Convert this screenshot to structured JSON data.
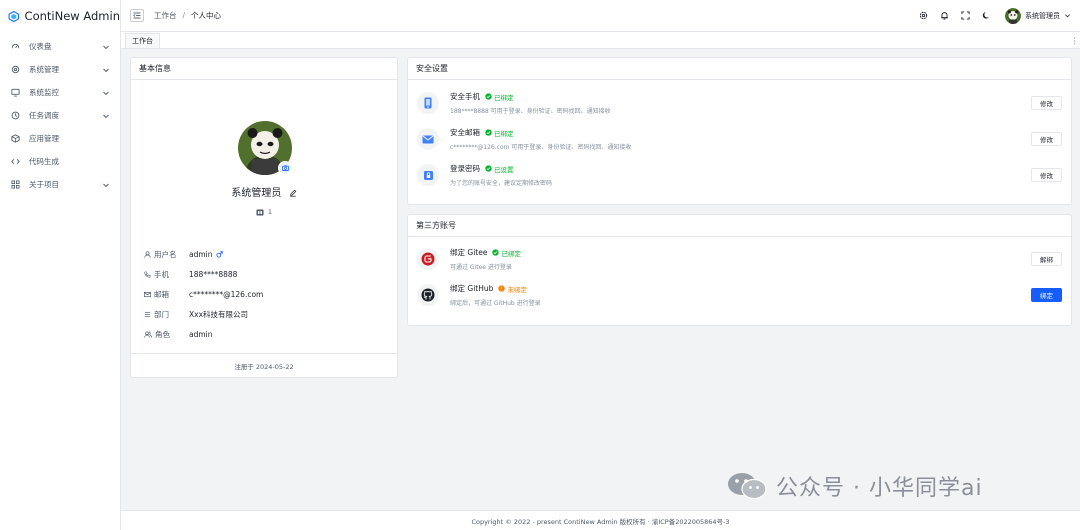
{
  "app": {
    "title": "ContiNew Admin"
  },
  "sidebar": {
    "items": [
      {
        "label": "仪表盘",
        "icon": "dashboard-icon",
        "expandable": true
      },
      {
        "label": "系统管理",
        "icon": "settings-icon",
        "expandable": true
      },
      {
        "label": "系统监控",
        "icon": "monitor-icon",
        "expandable": true
      },
      {
        "label": "任务调度",
        "icon": "schedule-icon",
        "expandable": true
      },
      {
        "label": "应用管理",
        "icon": "app-icon",
        "expandable": false
      },
      {
        "label": "代码生成",
        "icon": "code-icon",
        "expandable": false
      },
      {
        "label": "关于项目",
        "icon": "apps-grid-icon",
        "expandable": true
      }
    ]
  },
  "header": {
    "breadcrumb": [
      "工作台",
      "个人中心"
    ],
    "user_name": "系统管理员"
  },
  "tabs": [
    {
      "label": "工作台"
    }
  ],
  "basic_info": {
    "title": "基本信息",
    "nickname": "系统管理员",
    "id_value": "1",
    "fields": [
      {
        "label": "用户名",
        "value": "admin",
        "icon": "user-icon"
      },
      {
        "label": "手机",
        "value": "188****8888",
        "icon": "phone-icon"
      },
      {
        "label": "邮箱",
        "value": "c********@126.com",
        "icon": "email-icon"
      },
      {
        "label": "部门",
        "value": "Xxx科技有限公司",
        "icon": "department-icon"
      },
      {
        "label": "角色",
        "value": "admin",
        "icon": "role-icon"
      }
    ],
    "register_text": "注册于 2024-05-22"
  },
  "security": {
    "title": "安全设置",
    "items": [
      {
        "title": "安全手机",
        "status": "已绑定",
        "desc": "188****8888 可用于登录、身份验证、密码找回、通知接收",
        "button": "修改"
      },
      {
        "title": "安全邮箱",
        "status": "已绑定",
        "desc": "c********@126.com 可用于登录、身份验证、密码找回、通知接收",
        "button": "修改"
      },
      {
        "title": "登录密码",
        "status": "已设置",
        "desc": "为了您的账号安全，建议定期修改密码",
        "button": "修改"
      }
    ]
  },
  "third_party": {
    "title": "第三方账号",
    "items": [
      {
        "title": "绑定 Gitee",
        "status": "已绑定",
        "desc": "可通过 Gitee 进行登录",
        "button": "解绑"
      },
      {
        "title": "绑定 GitHub",
        "status": "未绑定",
        "desc": "绑定后，可通过 GitHub 进行登录",
        "button": "绑定"
      }
    ]
  },
  "footer": {
    "text": "Copyright © 2022 - present ContiNew Admin 版权所有 · 渝ICP备2022005864号-3"
  },
  "watermark": {
    "text": "公众号 · 小华同学ai"
  },
  "colors": {
    "primary": "#165dff",
    "success": "#00b42a",
    "warning": "#ff7d00",
    "gitee": "#c71d23"
  }
}
